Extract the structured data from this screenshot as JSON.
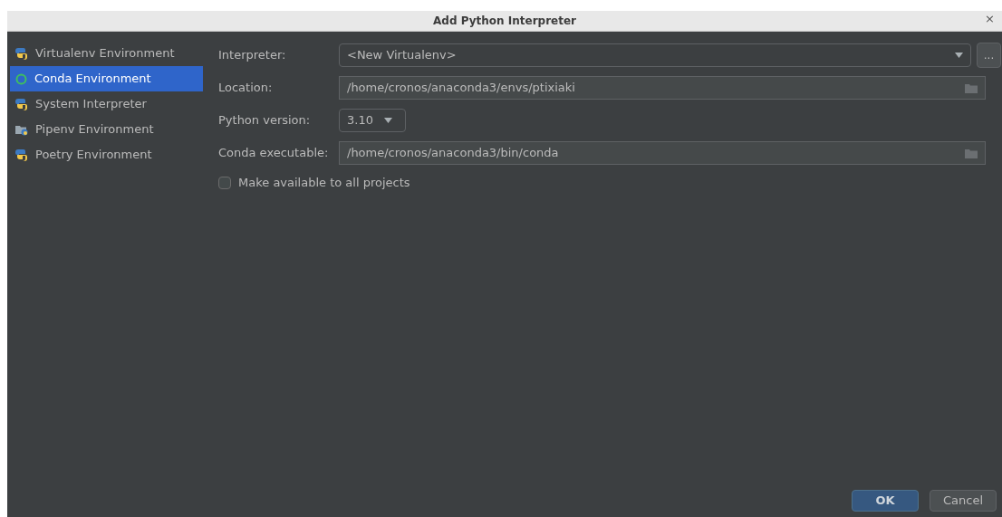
{
  "window": {
    "title": "Add Python Interpreter",
    "close": "×"
  },
  "sidebar": {
    "items": [
      {
        "label": "Virtualenv Environment",
        "kind": "python",
        "selected": false
      },
      {
        "label": "Conda Environment",
        "kind": "conda",
        "selected": true
      },
      {
        "label": "System Interpreter",
        "kind": "python",
        "selected": false
      },
      {
        "label": "Pipenv Environment",
        "kind": "pipenv",
        "selected": false
      },
      {
        "label": "Poetry Environment",
        "kind": "python",
        "selected": false
      }
    ]
  },
  "form": {
    "rows": [
      {
        "label": "Interpreter:",
        "kind": "combo",
        "value": "<New Virtualenv>",
        "extra": "..."
      },
      {
        "label": "Location:",
        "kind": "path",
        "value": "/home/cronos/anaconda3/envs/ptixiaki"
      },
      {
        "label": "Python version:",
        "kind": "select",
        "value": "3.10"
      },
      {
        "label": "Conda executable:",
        "kind": "path",
        "value": "/home/cronos/anaconda3/bin/conda"
      }
    ],
    "checkbox": {
      "label": "Make available to all projects",
      "checked": false
    }
  },
  "buttons": [
    {
      "label": "OK",
      "kind": "primary"
    },
    {
      "label": "Cancel",
      "kind": "secondary"
    }
  ]
}
